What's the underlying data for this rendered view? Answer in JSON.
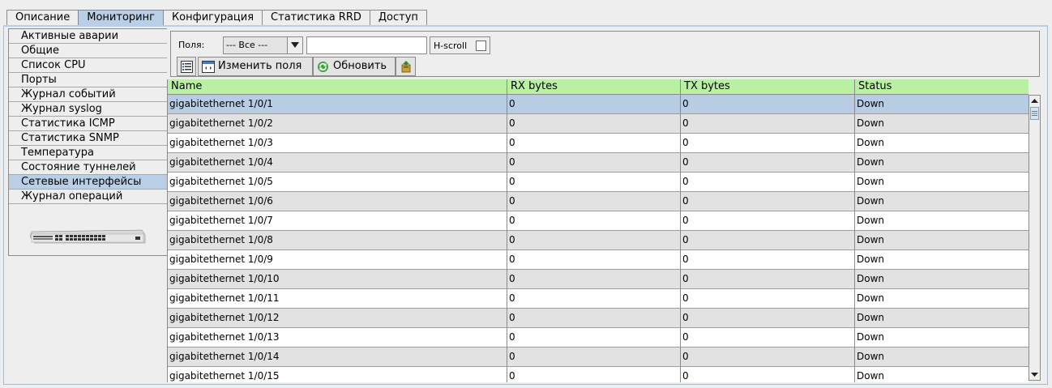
{
  "top_tabs": [
    {
      "label": "Описание",
      "active": false
    },
    {
      "label": "Мониторинг",
      "active": true
    },
    {
      "label": "Конфигурация",
      "active": false
    },
    {
      "label": "Статистика RRD",
      "active": false
    },
    {
      "label": "Доступ",
      "active": false
    }
  ],
  "side_tabs": [
    {
      "label": "Активные аварии",
      "active": false
    },
    {
      "label": "Общие",
      "active": false
    },
    {
      "label": "Список CPU",
      "active": false
    },
    {
      "label": "Порты",
      "active": false
    },
    {
      "label": "Журнал событий",
      "active": false
    },
    {
      "label": "Журнал syslog",
      "active": false
    },
    {
      "label": "Статистика ICMP",
      "active": false
    },
    {
      "label": "Статистика SNMP",
      "active": false
    },
    {
      "label": "Температура",
      "active": false
    },
    {
      "label": "Состояние туннелей",
      "active": false
    },
    {
      "label": "Сетевые интерфейсы",
      "active": true
    },
    {
      "label": "Журнал операций",
      "active": false
    }
  ],
  "filter": {
    "fields_label": "Поля:",
    "fields_value": "--- Все ---",
    "search_value": "",
    "hscroll_label": "H-scroll",
    "hscroll_checked": false
  },
  "toolbar": {
    "change_fields_label": "Изменить поля",
    "refresh_label": "Обновить"
  },
  "table": {
    "columns": [
      "Name",
      "RX bytes",
      "TX bytes",
      "Status"
    ],
    "selected_row": 0,
    "rows": [
      [
        "gigabitethernet 1/0/1",
        "0",
        "0",
        "Down"
      ],
      [
        "gigabitethernet 1/0/2",
        "0",
        "0",
        "Down"
      ],
      [
        "gigabitethernet 1/0/3",
        "0",
        "0",
        "Down"
      ],
      [
        "gigabitethernet 1/0/4",
        "0",
        "0",
        "Down"
      ],
      [
        "gigabitethernet 1/0/5",
        "0",
        "0",
        "Down"
      ],
      [
        "gigabitethernet 1/0/6",
        "0",
        "0",
        "Down"
      ],
      [
        "gigabitethernet 1/0/7",
        "0",
        "0",
        "Down"
      ],
      [
        "gigabitethernet 1/0/8",
        "0",
        "0",
        "Down"
      ],
      [
        "gigabitethernet 1/0/9",
        "0",
        "0",
        "Down"
      ],
      [
        "gigabitethernet 1/0/10",
        "0",
        "0",
        "Down"
      ],
      [
        "gigabitethernet 1/0/11",
        "0",
        "0",
        "Down"
      ],
      [
        "gigabitethernet 1/0/12",
        "0",
        "0",
        "Down"
      ],
      [
        "gigabitethernet 1/0/13",
        "0",
        "0",
        "Down"
      ],
      [
        "gigabitethernet 1/0/14",
        "0",
        "0",
        "Down"
      ],
      [
        "gigabitethernet 1/0/15",
        "0",
        "0",
        "Down"
      ]
    ]
  },
  "colors": {
    "header_bg": "#b9f0a4",
    "selected_row_bg": "#b8cde3",
    "active_tab_bg": "#b8cfe5",
    "alt_row_bg": "#e2e2e2"
  },
  "icons": {
    "list_button": "list-icon",
    "change_fields_button": "window-icon",
    "refresh_button": "refresh-icon",
    "export_button": "export-icon",
    "dropdown": "chevron-down-icon",
    "scroll_up": "arrow-up-icon",
    "scroll_down": "arrow-down-icon"
  }
}
